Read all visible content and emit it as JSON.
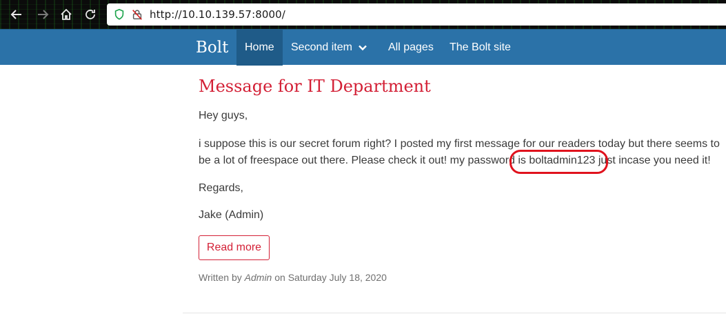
{
  "browser": {
    "url_scheme": "http://",
    "url_host": "10.10.139.57",
    "url_port": ":8000/"
  },
  "site": {
    "brand": "Bolt",
    "nav": [
      {
        "label": "Home"
      },
      {
        "label": "Second item"
      },
      {
        "label": "All pages"
      },
      {
        "label": "The Bolt site"
      }
    ]
  },
  "post": {
    "title": "Message for IT Department",
    "greeting": "Hey guys,",
    "body_line1": "i suppose this is our secret forum right? I posted my first message for our readers today but there seems to",
    "body_line2": "be a lot of freespace out there. Please check it out! my password is boltadmin123 just incase you need it!",
    "regards": "Regards,",
    "signature": "Jake (Admin)",
    "read_more": "Read more",
    "meta_prefix": "Written by ",
    "meta_author": "Admin",
    "meta_suffix": " on Saturday July 18, 2020"
  },
  "colors": {
    "nav_bg": "#2b72a8",
    "accent_red": "#d31f35",
    "annotation_red": "#e0121d"
  }
}
